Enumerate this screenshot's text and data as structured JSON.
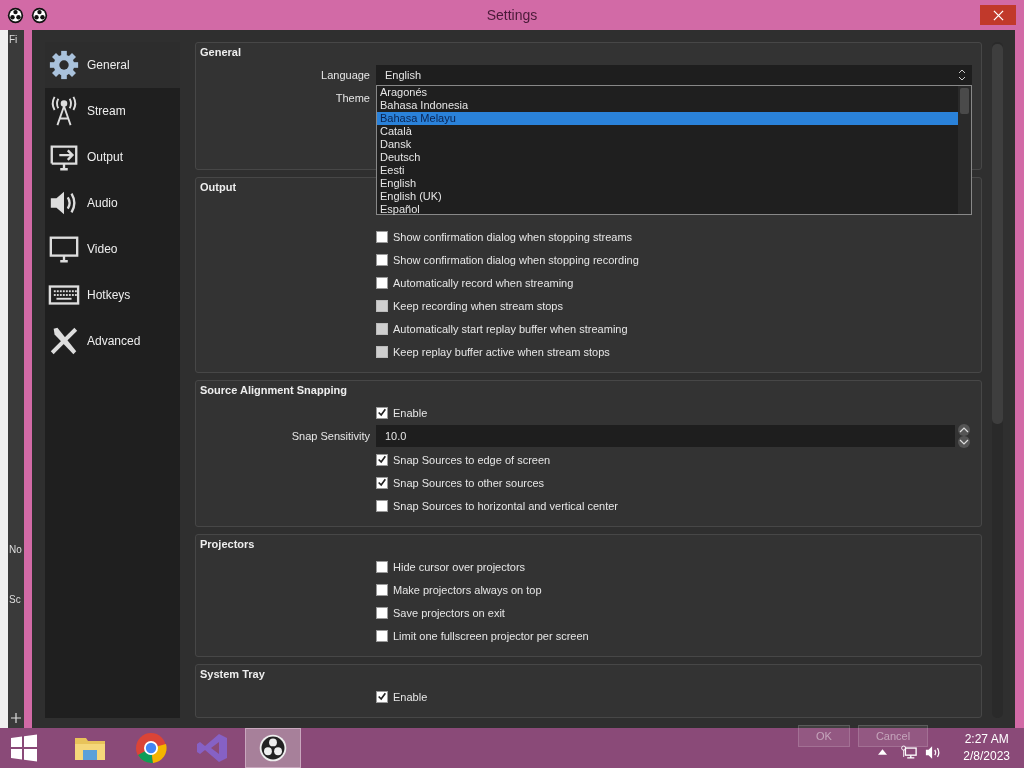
{
  "background_window": {
    "fragments": [
      "Fi",
      "No",
      "Sc"
    ]
  },
  "window": {
    "title": "Settings"
  },
  "sidebar": {
    "items": [
      {
        "label": "General",
        "selected": true
      },
      {
        "label": "Stream",
        "selected": false
      },
      {
        "label": "Output",
        "selected": false
      },
      {
        "label": "Audio",
        "selected": false
      },
      {
        "label": "Video",
        "selected": false
      },
      {
        "label": "Hotkeys",
        "selected": false
      },
      {
        "label": "Advanced",
        "selected": false
      }
    ]
  },
  "groups": [
    {
      "title": "General",
      "rows": [
        {
          "kind": "combo",
          "label": "Language",
          "value": "English",
          "open": true
        },
        {
          "kind": "combo",
          "label": "Theme",
          "open": false
        }
      ]
    },
    {
      "title": "Output",
      "rows": [
        {
          "kind": "checkbox",
          "label": "Show confirmation dialog when stopping streams",
          "checked": false,
          "disabled": false
        },
        {
          "kind": "checkbox",
          "label": "Show confirmation dialog when stopping recording",
          "checked": false,
          "disabled": false
        },
        {
          "kind": "checkbox",
          "label": "Automatically record when streaming",
          "checked": false,
          "disabled": false
        },
        {
          "kind": "checkbox",
          "label": "Keep recording when stream stops",
          "checked": false,
          "disabled": true
        },
        {
          "kind": "checkbox",
          "label": "Automatically start replay buffer when streaming",
          "checked": false,
          "disabled": true
        },
        {
          "kind": "checkbox",
          "label": "Keep replay buffer active when stream stops",
          "checked": false,
          "disabled": true
        }
      ]
    },
    {
      "title": "Source Alignment Snapping",
      "rows": [
        {
          "kind": "checkbox",
          "label": "Enable",
          "checked": true,
          "disabled": false
        },
        {
          "kind": "spin",
          "label": "Snap Sensitivity",
          "value": "10.0"
        },
        {
          "kind": "checkbox",
          "label": "Snap Sources to edge of screen",
          "checked": true,
          "disabled": false
        },
        {
          "kind": "checkbox",
          "label": "Snap Sources to other sources",
          "checked": true,
          "disabled": false
        },
        {
          "kind": "checkbox",
          "label": "Snap Sources to horizontal and vertical center",
          "checked": false,
          "disabled": false
        }
      ]
    },
    {
      "title": "Projectors",
      "rows": [
        {
          "kind": "checkbox",
          "label": "Hide cursor over projectors",
          "checked": false,
          "disabled": false
        },
        {
          "kind": "checkbox",
          "label": "Make projectors always on top",
          "checked": false,
          "disabled": false
        },
        {
          "kind": "checkbox",
          "label": "Save projectors on exit",
          "checked": false,
          "disabled": false
        },
        {
          "kind": "checkbox",
          "label": "Limit one fullscreen projector per screen",
          "checked": false,
          "disabled": false
        }
      ]
    },
    {
      "title": "System Tray",
      "rows": [
        {
          "kind": "checkbox",
          "label": "Enable",
          "checked": true,
          "disabled": false
        }
      ]
    }
  ],
  "language_list": {
    "options": [
      {
        "label": "Aragonés",
        "selected": false
      },
      {
        "label": "Bahasa Indonesia",
        "selected": false
      },
      {
        "label": "Bahasa Melayu",
        "selected": true
      },
      {
        "label": "Català",
        "selected": false
      },
      {
        "label": "Dansk",
        "selected": false
      },
      {
        "label": "Deutsch",
        "selected": false
      },
      {
        "label": "Eesti",
        "selected": false
      },
      {
        "label": "English",
        "selected": false
      },
      {
        "label": "English (UK)",
        "selected": false
      },
      {
        "label": "Español",
        "selected": false
      }
    ]
  },
  "dialog_buttons": [
    "OK",
    "Cancel"
  ],
  "taskbar": {
    "apps": [
      {
        "selected": false
      },
      {
        "selected": false
      },
      {
        "selected": false
      },
      {
        "selected": true
      }
    ],
    "time": "2:27 AM",
    "date": "2/8/2023"
  }
}
